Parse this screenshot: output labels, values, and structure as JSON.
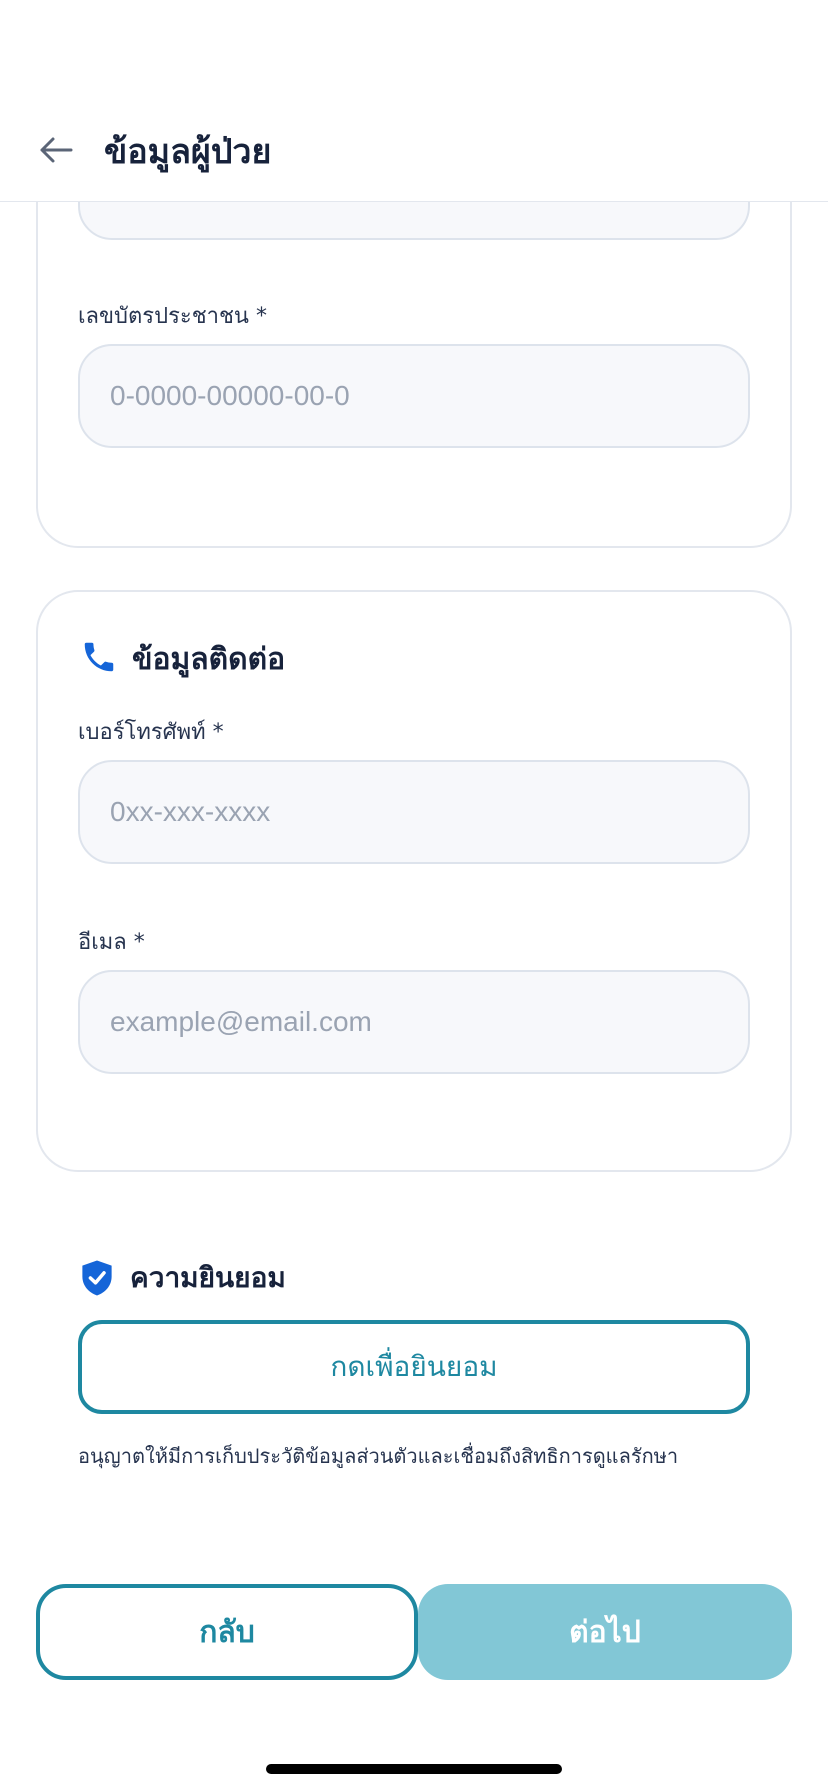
{
  "header": {
    "title": "ข้อมูลผู้ป่วย",
    "back_icon": "arrow-left-icon"
  },
  "personal": {
    "id_label": "เลขบัตรประชาชน *",
    "id_placeholder": "0-0000-00000-00-0"
  },
  "contact": {
    "title": "ข้อมูลติดต่อ",
    "icon": "phone-icon",
    "phone_label": "เบอร์โทรศัพท์ *",
    "phone_placeholder": "0xx-xxx-xxxx",
    "email_label": "อีเมล *",
    "email_placeholder": "example@email.com"
  },
  "consent": {
    "title": "ความยินยอม",
    "icon": "shield-check-icon",
    "button_label": "กดเพื่อยินยอม",
    "description": "อนุญาตให้มีการเก็บประวัติข้อมูลส่วนตัวและเชื่อมถึงสิทธิการดูแลรักษา"
  },
  "footer": {
    "back_label": "กลับ",
    "next_label": "ต่อไป"
  },
  "colors": {
    "accent": "#1e88a1",
    "accent_disabled": "#82c7d6",
    "phone_icon": "#1565d8",
    "shield_icon": "#1565d8"
  }
}
